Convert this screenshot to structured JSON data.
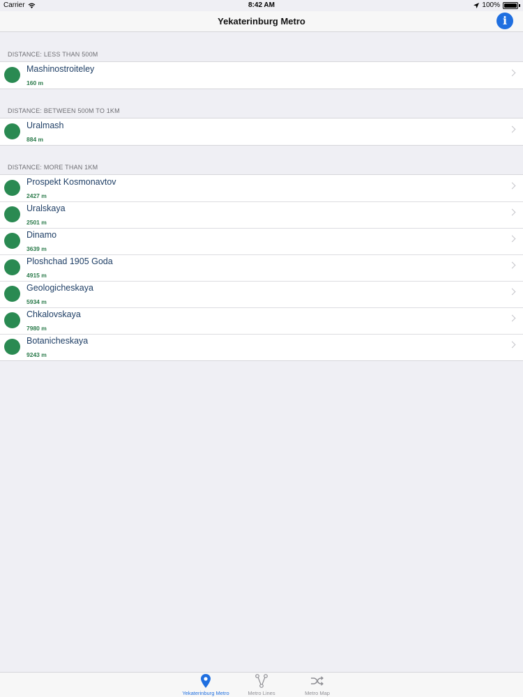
{
  "status": {
    "carrier": "Carrier",
    "time": "8:42 AM",
    "battery": "100%"
  },
  "nav": {
    "title": "Yekaterinburg Metro",
    "info_icon": "i"
  },
  "sections": [
    {
      "header": "DISTANCE: LESS THAN 500M",
      "items": [
        {
          "name": "Mashinostroiteley",
          "distance": "160 m"
        }
      ]
    },
    {
      "header": "DISTANCE: BETWEEN 500M TO 1KM",
      "items": [
        {
          "name": "Uralmash",
          "distance": "884 m"
        }
      ]
    },
    {
      "header": "DISTANCE: MORE THAN 1KM",
      "items": [
        {
          "name": "Prospekt Kosmonavtov",
          "distance": "2427 m"
        },
        {
          "name": "Uralskaya",
          "distance": "2501 m"
        },
        {
          "name": "Dinamo",
          "distance": "3639 m"
        },
        {
          "name": "Ploshchad 1905 Goda",
          "distance": "4915 m"
        },
        {
          "name": "Geologicheskaya",
          "distance": "5934 m"
        },
        {
          "name": "Chkalovskaya",
          "distance": "7980 m"
        },
        {
          "name": "Botanicheskaya",
          "distance": "9243 m"
        }
      ]
    }
  ],
  "tabs": [
    {
      "label": "Yekaterinburg Metro",
      "icon": "location-pin-icon",
      "active": true
    },
    {
      "label": "Metro Lines",
      "icon": "metro-lines-icon",
      "active": false
    },
    {
      "label": "Metro Map",
      "icon": "shuffle-icon",
      "active": false
    }
  ],
  "colors": {
    "accent": "#1f6fe0",
    "station_dot": "#2a8a52",
    "distance_text": "#2a7a4a"
  }
}
